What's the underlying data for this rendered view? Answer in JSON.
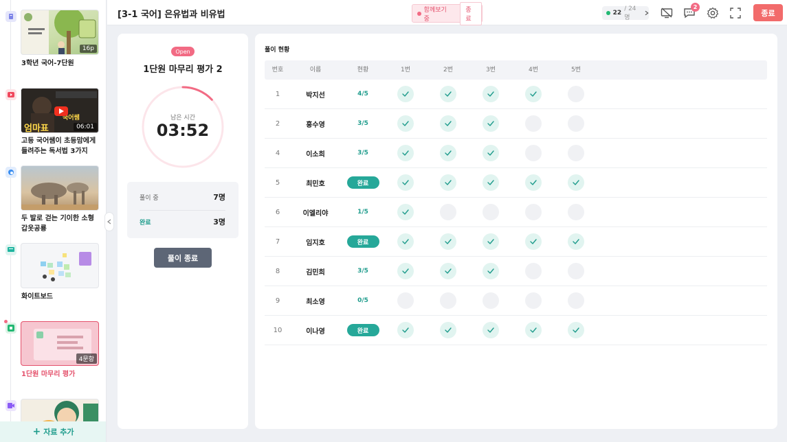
{
  "sidebar": {
    "items": [
      {
        "title": "3학년 국어-7단원",
        "badge": "16p"
      },
      {
        "title": "고등 국어쌤이 초등맘에게 들려주는 독서법 3가지",
        "badge": "06:01"
      },
      {
        "title": "두 발로 걷는 기이한 소형 갑옷공룡",
        "badge": ""
      },
      {
        "title": "화이트보드",
        "badge": ""
      },
      {
        "title": "1단원 마무리 평가",
        "badge": "4문항"
      },
      {
        "title": "",
        "badge": ""
      }
    ],
    "add_label": "자료 추가",
    "colors": {
      "book": "#7c83e8",
      "youtube": "#f0485d",
      "web": "#3b8ef0",
      "board": "#1fb5a0",
      "quiz": "#22b873",
      "video": "#8b5cf6",
      "active": "#e4506b"
    }
  },
  "header": {
    "title": "[3-1 국어] 은유법과 비유법",
    "coview_text": "함께보기 중",
    "coview_end": "종료",
    "online_count": "22",
    "online_total": "/ 24명",
    "notif_count": "2",
    "end_label": "종료"
  },
  "quiz": {
    "status": "Open",
    "title": "1단원 마무리 평가 2",
    "timer_label": "남은 시간",
    "timer_value": "03:52",
    "timer_progress": 0.13,
    "solving_label": "풀이 중",
    "solving_count": "7명",
    "done_label": "완료",
    "done_count": "3명",
    "finish_label": "풀이 종료"
  },
  "status_table": {
    "title": "풀이 현황",
    "headers": [
      "번호",
      "이름",
      "현황",
      "1번",
      "2번",
      "3번",
      "4번",
      "5번"
    ],
    "rows": [
      {
        "num": "1",
        "name": "박지선",
        "status": "4/5",
        "done": false,
        "checks": [
          true,
          true,
          true,
          true,
          false
        ]
      },
      {
        "num": "2",
        "name": "홍수영",
        "status": "3/5",
        "done": false,
        "checks": [
          true,
          true,
          true,
          false,
          false
        ]
      },
      {
        "num": "4",
        "name": "이소희",
        "status": "3/5",
        "done": false,
        "checks": [
          true,
          true,
          true,
          false,
          false
        ]
      },
      {
        "num": "5",
        "name": "최민호",
        "status": "완료",
        "done": true,
        "checks": [
          true,
          true,
          true,
          true,
          true
        ]
      },
      {
        "num": "6",
        "name": "이엘리야",
        "status": "1/5",
        "done": false,
        "checks": [
          true,
          false,
          false,
          false,
          false
        ]
      },
      {
        "num": "7",
        "name": "임지호",
        "status": "완료",
        "done": true,
        "checks": [
          true,
          true,
          true,
          true,
          true
        ]
      },
      {
        "num": "8",
        "name": "김민희",
        "status": "3/5",
        "done": false,
        "checks": [
          true,
          true,
          true,
          false,
          false
        ]
      },
      {
        "num": "9",
        "name": "최소영",
        "status": "0/5",
        "done": false,
        "checks": [
          false,
          false,
          false,
          false,
          false
        ]
      },
      {
        "num": "10",
        "name": "이나영",
        "status": "완료",
        "done": true,
        "checks": [
          true,
          true,
          true,
          true,
          true
        ]
      }
    ]
  }
}
